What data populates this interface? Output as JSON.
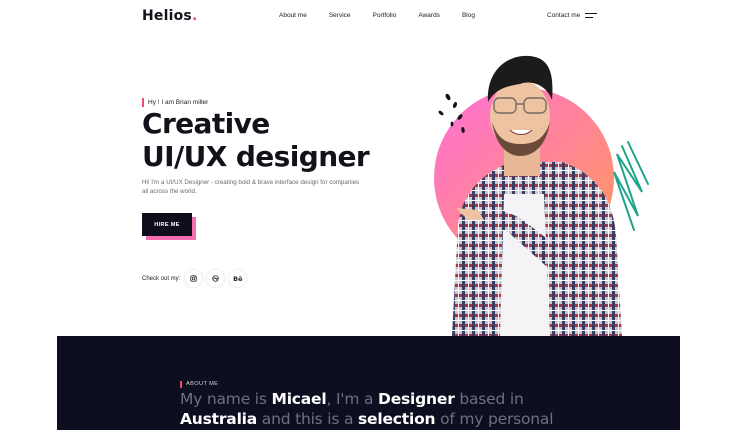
{
  "nav": {
    "logo": "Helios",
    "logo_dot": ".",
    "menu": [
      "About me",
      "Service",
      "Portfolio",
      "Awards",
      "Blog"
    ],
    "contact": "Contact me"
  },
  "hero": {
    "greeting": "Hy ! I am Brian miller",
    "title_line1": "Creative",
    "title_line2": "UI/UX designer",
    "description": "Hi! I'm a UI/UX Designer - creating bold & brave interface design for companies all across the world.",
    "cta": "HIRE ME",
    "social_label": "Check out my:",
    "socials": [
      "instagram-icon",
      "dribbble-icon",
      "behance-icon"
    ],
    "behance_text": "Bē"
  },
  "about": {
    "label": "ABOUT ME",
    "parts": [
      {
        "t": "My name is ",
        "b": false
      },
      {
        "t": "Micael",
        "b": true
      },
      {
        "t": ", I'm a ",
        "b": false
      },
      {
        "t": "Designer",
        "b": true
      },
      {
        "t": " based in ",
        "b": false
      },
      {
        "t": "Australia",
        "b": true
      },
      {
        "t": " and this is a ",
        "b": false
      },
      {
        "t": "selection",
        "b": true
      },
      {
        "t": " of my personal",
        "b": false
      }
    ]
  },
  "colors": {
    "accent": "#f24a6e",
    "dark": "#0d0e20",
    "gradient_start": "#ff6fd8",
    "gradient_end": "#ff9a56",
    "scribble": "#1fa58a"
  }
}
